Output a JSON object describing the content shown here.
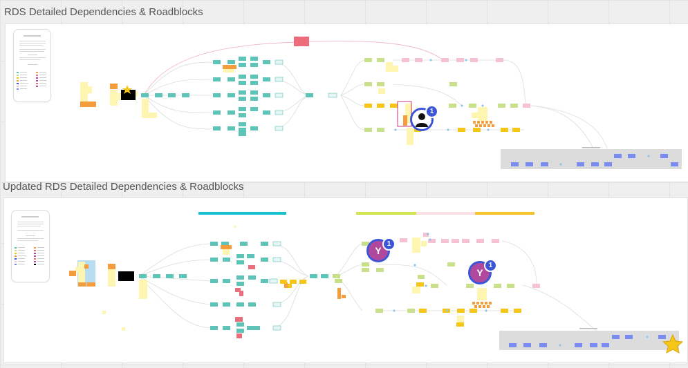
{
  "frames": [
    {
      "title": "RDS Detailed Dependencies & Roadblocks"
    },
    {
      "title": "Updated RDS Detailed Dependencies & Roadblocks"
    }
  ],
  "collaborators": [
    {
      "initial": "",
      "count": "1",
      "color": "#3c55d8"
    },
    {
      "initial": "Y",
      "count": "1",
      "color": "#b0489e"
    },
    {
      "initial": "Y",
      "count": "1",
      "color": "#b0489e"
    }
  ],
  "colors": {
    "teal": "#5ec4b8",
    "yellow_note": "#fdf5b0",
    "orange": "#f59c3c",
    "amber": "#f5c518",
    "lime": "#c8e08a",
    "pink": "#f7c1d4",
    "blue": "#7b8cf0",
    "red": "#e8707e",
    "cyan_band": "#19c2cf",
    "lime_band": "#cfe34a",
    "pink_band": "#fbe0e6",
    "amber_band": "#f3c428",
    "star": "#f5c518"
  }
}
